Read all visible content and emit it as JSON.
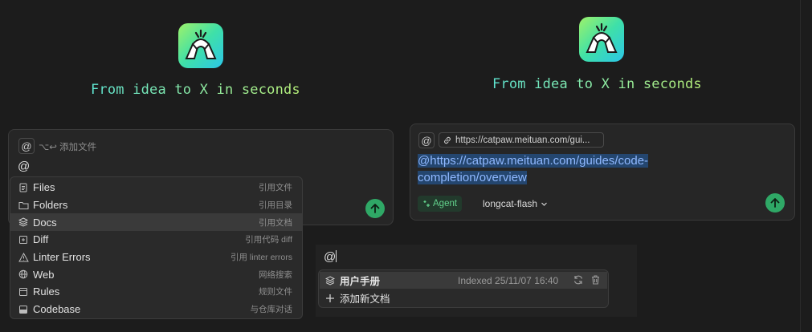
{
  "left": {
    "tagline": "From idea to X in seconds",
    "panel": {
      "at_symbol": "@",
      "add_file_hint": "⌥↩ 添加文件",
      "input_value": "@"
    },
    "menu": [
      {
        "label": "Files",
        "hint": "引用文件",
        "icon": "file-icon"
      },
      {
        "label": "Folders",
        "hint": "引用目录",
        "icon": "folder-icon"
      },
      {
        "label": "Docs",
        "hint": "引用文档",
        "icon": "layers-icon",
        "active": true
      },
      {
        "label": "Diff",
        "hint": "引用代码 diff",
        "icon": "diff-icon"
      },
      {
        "label": "Linter Errors",
        "hint": "引用 linter errors",
        "icon": "warning-icon"
      },
      {
        "label": "Web",
        "hint": "网络搜索",
        "icon": "globe-icon"
      },
      {
        "label": "Rules",
        "hint": "规则文件",
        "icon": "rules-icon"
      },
      {
        "label": "Codebase",
        "hint": "与仓库对话",
        "icon": "codebase-icon"
      }
    ]
  },
  "right": {
    "tagline": "From idea to X in seconds",
    "panel": {
      "at_symbol": "@",
      "link_chip": "https://catpaw.meituan.com/gui...",
      "url_line1": "@https://catpaw.meituan.com/guides/code-",
      "url_line2": "completion/overview",
      "agent_label": "Agent",
      "model_label": "longcat-flash"
    }
  },
  "bottom": {
    "input_value": "@",
    "doc": {
      "name": "用户手册",
      "indexed": "Indexed 25/11/07 16:40"
    },
    "add_doc": "添加新文档"
  },
  "colors": {
    "accent_green": "#2fa866",
    "link_blue": "#8fb8ff",
    "agent_green": "#63d28c"
  }
}
